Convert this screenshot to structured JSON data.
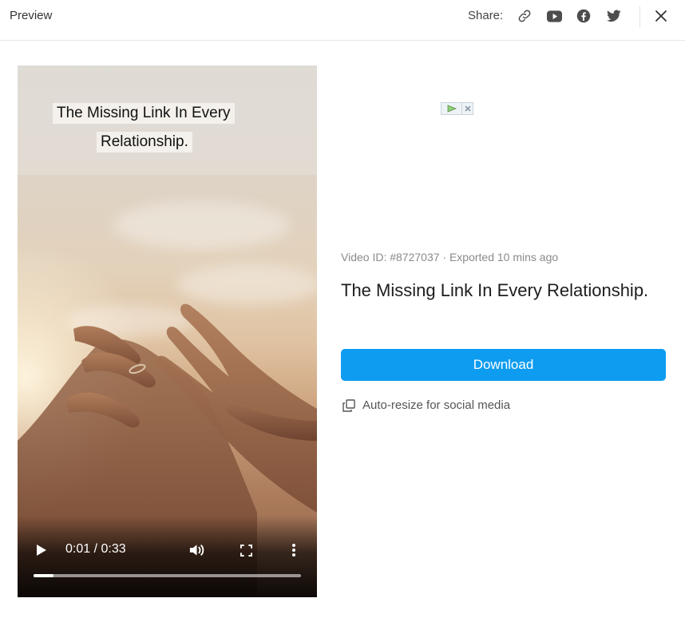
{
  "header": {
    "title": "Preview",
    "share_label": "Share:",
    "icons": [
      "link-icon",
      "youtube-icon",
      "facebook-icon",
      "twitter-icon",
      "close-icon"
    ]
  },
  "video": {
    "caption_lines": [
      "The Missing Link In Every",
      "Relationship."
    ],
    "time_display": "0:01 / 0:33",
    "progress": 0.075,
    "controls_icons": [
      "play-icon",
      "volume-icon",
      "fullscreen-icon",
      "more-options-icon"
    ]
  },
  "details": {
    "meta": "Video ID: #8727037 · Exported 10 mins ago",
    "title": "The Missing Link In Every Relationship.",
    "download_label": "Download",
    "auto_resize_label": "Auto-resize for social media"
  },
  "colors": {
    "accent": "#0e9cf0",
    "icon": "#4d4d4d",
    "muted_text": "#8a8a8a"
  }
}
